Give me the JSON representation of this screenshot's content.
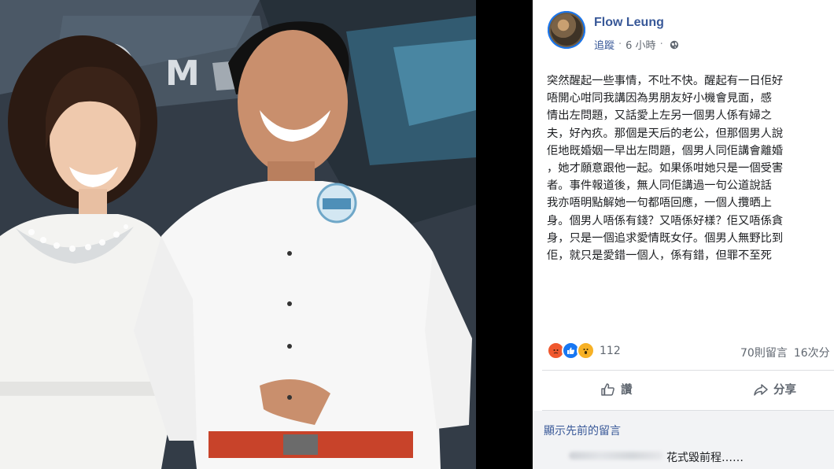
{
  "post": {
    "author": "Flow Leung",
    "meta": {
      "follow": "追蹤",
      "time": "6 小時",
      "privacy_icon": "globe-icon"
    },
    "text_lines": [
      "突然醒起一些事情，不吐不快。醒起有一日佢好",
      "唔開心咁同我講因為男朋友好小機會見面，感",
      "情出左問題，又話愛上左另一個男人係有婦之",
      "夫，好內疚。那個是天后的老公，但那個男人說",
      "佢地既婚姻一早出左問題，個男人同佢講會離婚",
      "，她才願意跟他一起。如果係咁她只是一個受害",
      "者。事件報道後，無人同佢講過一句公道說話",
      "我亦唔明點解她一句都唔回應，一個人攬晒上",
      "身。個男人唔係有錢？又唔係好樣？佢又唔係貪",
      "身，只是一個追求愛情既女仔。個男人無野比到",
      "佢，就只是愛錯一個人，係有錯，但罪不至死"
    ],
    "reactions": {
      "icons": [
        "angry-icon",
        "like-icon",
        "wow-icon"
      ],
      "count": "112"
    },
    "comments_count": "70則留言",
    "shares_count": "16次分",
    "actions": {
      "like": "讚",
      "share": "分享"
    },
    "show_previous": "顯示先前的留言",
    "comment": {
      "text": "花式毀前程……"
    }
  },
  "colors": {
    "link": "#385898",
    "meta": "#606770",
    "accent": "#1877f2"
  }
}
